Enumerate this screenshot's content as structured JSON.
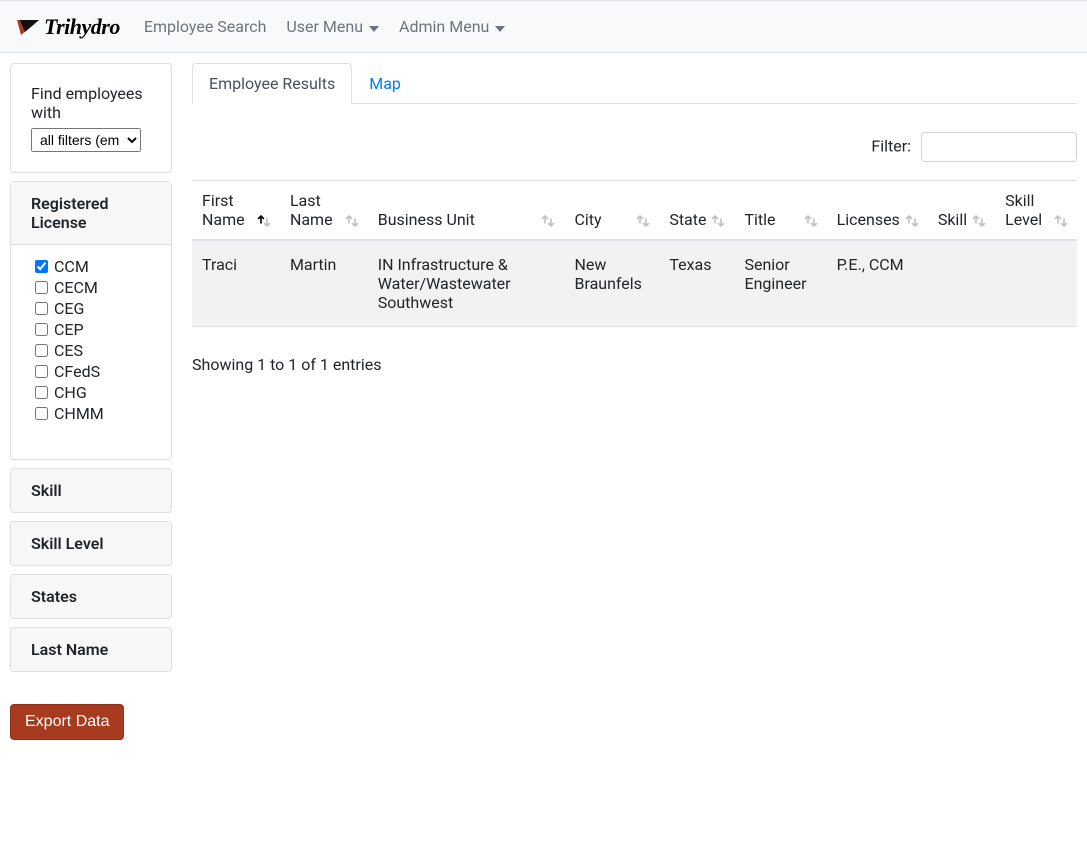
{
  "navbar": {
    "brand": "Trihydro",
    "items": [
      {
        "label": "Employee Search",
        "dropdown": false
      },
      {
        "label": "User Menu",
        "dropdown": true
      },
      {
        "label": "Admin Menu",
        "dropdown": true
      }
    ]
  },
  "sidebar": {
    "find_label": "Find employees with",
    "find_select_value": "all filters (employee match)",
    "panels": {
      "license_title": "Registered License",
      "skill_title": "Skill",
      "skill_level_title": "Skill Level",
      "states_title": "States",
      "last_name_title": "Last Name"
    },
    "licenses": [
      {
        "label": "CCM",
        "checked": true
      },
      {
        "label": "CECM",
        "checked": false
      },
      {
        "label": "CEG",
        "checked": false
      },
      {
        "label": "CEP",
        "checked": false
      },
      {
        "label": "CES",
        "checked": false
      },
      {
        "label": "CFedS",
        "checked": false
      },
      {
        "label": "CHG",
        "checked": false
      },
      {
        "label": "CHMM",
        "checked": false
      }
    ],
    "export_label": "Export Data"
  },
  "tabs": {
    "results": "Employee Results",
    "map": "Map"
  },
  "table": {
    "filter_label": "Filter:",
    "filter_value": "",
    "columns": [
      "First Name",
      "Last Name",
      "Business Unit",
      "City",
      "State",
      "Title",
      "Licenses",
      "Skill",
      "Skill Level"
    ],
    "rows": [
      {
        "first_name": "Traci",
        "last_name": "Martin",
        "business_unit": "IN Infrastructure & Water/Wastewater Southwest",
        "city": "New Braunfels",
        "state": "Texas",
        "title": "Senior Engineer",
        "licenses": "P.E., CCM",
        "skill": "",
        "skill_level": ""
      }
    ],
    "info": "Showing 1 to 1 of 1 entries"
  }
}
